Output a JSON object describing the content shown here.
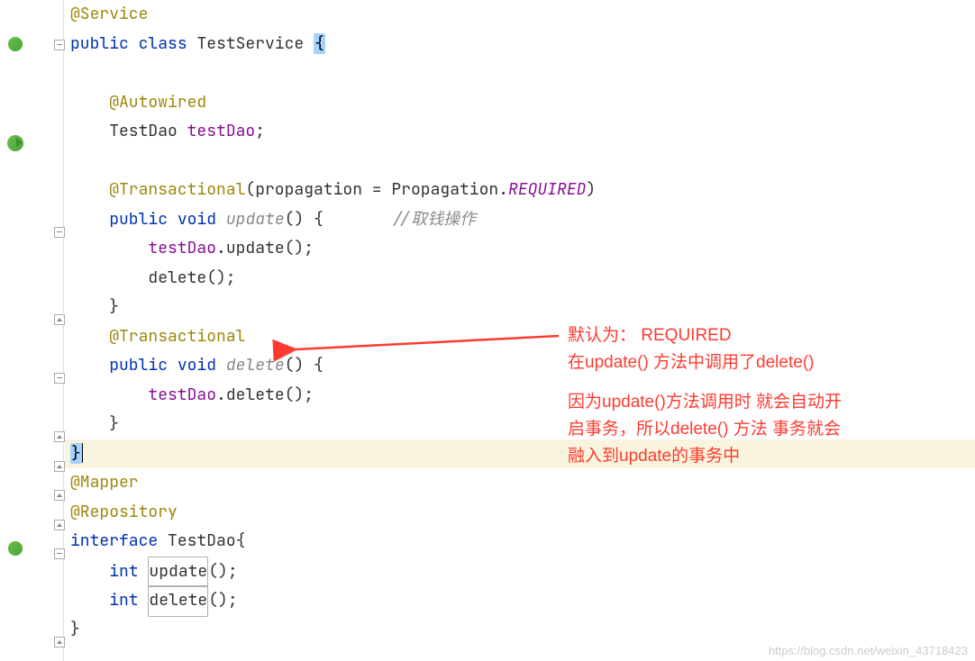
{
  "code": {
    "l1_anno": "@Service",
    "l2_kw1": "public",
    "l2_kw2": "class",
    "l2_type": "TestService",
    "l2_brace": "{",
    "l4_anno": "@Autowired",
    "l5_type": "TestDao",
    "l5_field": "testDao",
    "l5_semi": ";",
    "l7_anno": "@Transactional",
    "l7_open": "(propagation = Propagation.",
    "l7_const": "REQUIRED",
    "l7_close": ")",
    "l8_kw1": "public",
    "l8_kw2": "void",
    "l8_method": "update",
    "l8_paren": "() {",
    "l8_comment": "//取钱操作",
    "l9_field": "testDao",
    "l9_call": ".update();",
    "l10_call": "delete();",
    "l11_close": "}",
    "l12_anno": "@Transactional",
    "l13_kw1": "public",
    "l13_kw2": "void",
    "l13_method": "delete",
    "l13_paren": "() {",
    "l14_field": "testDao",
    "l14_call": ".delete();",
    "l15_close": "}",
    "l16_close": "}",
    "l17_anno": "@Mapper",
    "l18_anno": "@Repository",
    "l19_kw": "interface",
    "l19_type": "TestDao",
    "l19_brace": "{",
    "l20_kw": "int",
    "l20_method": "update",
    "l20_paren": "();",
    "l21_kw": "int",
    "l21_method": "delete",
    "l21_paren": "();",
    "l22_close": "}"
  },
  "annotation": {
    "line1": "默认为： REQUIRED",
    "line2": "在update() 方法中调用了delete()",
    "line3": "因为update()方法调用时 就会自动开",
    "line4": "启事务，所以delete() 方法 事务就会",
    "line5": "融入到update的事务中"
  },
  "watermark": "https://blog.csdn.net/weixin_43718423"
}
